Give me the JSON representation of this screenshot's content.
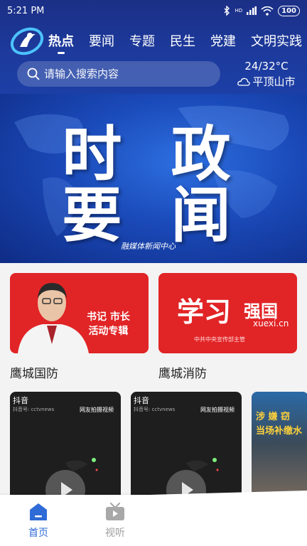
{
  "status_bar": {
    "time": "5:21 PM",
    "network_label": "HD",
    "battery": "100"
  },
  "nav": {
    "tabs": [
      {
        "label": "热点",
        "active": true
      },
      {
        "label": "要闻",
        "active": false
      },
      {
        "label": "专题",
        "active": false
      },
      {
        "label": "民生",
        "active": false
      },
      {
        "label": "党建",
        "active": false
      },
      {
        "label": "文明实践",
        "active": false
      }
    ]
  },
  "search": {
    "placeholder": "请输入搜索内容"
  },
  "weather": {
    "temp": "24/32°C",
    "city": "平顶山市",
    "icon": "cloud-icon"
  },
  "banner": {
    "line1": "时 政",
    "line2": "要 闻",
    "watermark": "融媒体新闻中心"
  },
  "cards": [
    {
      "title": "鹰城国防",
      "image_text": "书记 市长\n活动专辑"
    },
    {
      "title": "鹰城消防",
      "image_big": "学习",
      "image_brand": "强国",
      "image_url": "xuexi.cn",
      "image_sub": "中共中央宣传部主管"
    }
  ],
  "videos": [
    {
      "platform": "抖音",
      "account": "抖音号: cctvnews",
      "note": "网友拍摄视频"
    },
    {
      "platform": "抖音",
      "account": "抖音号: cctvnews",
      "note": "网友拍摄视频"
    },
    {
      "caption_line1": "涉 嫌 窃",
      "caption_line2": "当场补缴水"
    }
  ],
  "bottom_nav": [
    {
      "label": "首页",
      "active": true,
      "icon": "home-icon"
    },
    {
      "label": "视听",
      "active": false,
      "icon": "tv-icon"
    }
  ],
  "colors": {
    "header_blue": "#1d3a9c",
    "accent": "#2f6bd6",
    "card_red": "#e12426"
  }
}
